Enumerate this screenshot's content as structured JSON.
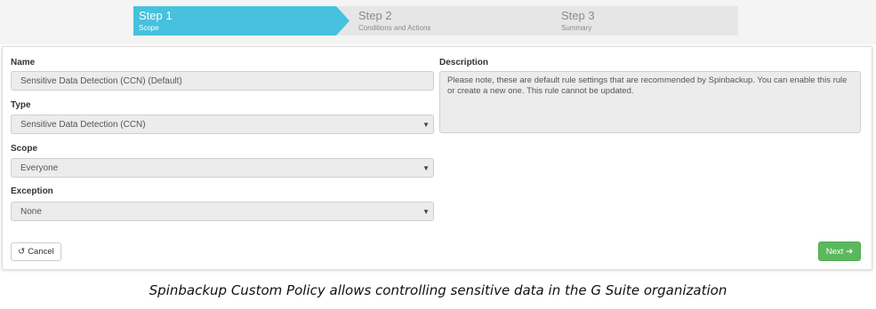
{
  "wizard": {
    "steps": [
      {
        "title": "Step 1",
        "subtitle": "Scope",
        "state": "active"
      },
      {
        "title": "Step 2",
        "subtitle": "Conditions and Actions",
        "state": "inactive"
      },
      {
        "title": "Step 3",
        "subtitle": "Summary",
        "state": "inactive"
      }
    ]
  },
  "form": {
    "name": {
      "label": "Name",
      "value": "Sensitive Data Detection (CCN) (Default)"
    },
    "type": {
      "label": "Type",
      "value": "Sensitive Data Detection (CCN)"
    },
    "scope": {
      "label": "Scope",
      "value": "Everyone"
    },
    "exception": {
      "label": "Exception",
      "value": "None"
    },
    "description": {
      "label": "Description",
      "value": "Please note, these are default rule settings that are recommended by Spinbackup. You can enable this rule or create a new one. This rule cannot be updated."
    }
  },
  "buttons": {
    "cancel": {
      "label": "Cancel",
      "icon": "undo-icon"
    },
    "next": {
      "label": "Next",
      "icon": "arrow-right-icon"
    }
  },
  "caption": "Spinbackup Custom Policy allows controlling sensitive data in the G Suite organization",
  "colors": {
    "active_step": "#46c1de",
    "inactive_step": "#e6e6e6",
    "next_button": "#5cb85c"
  }
}
